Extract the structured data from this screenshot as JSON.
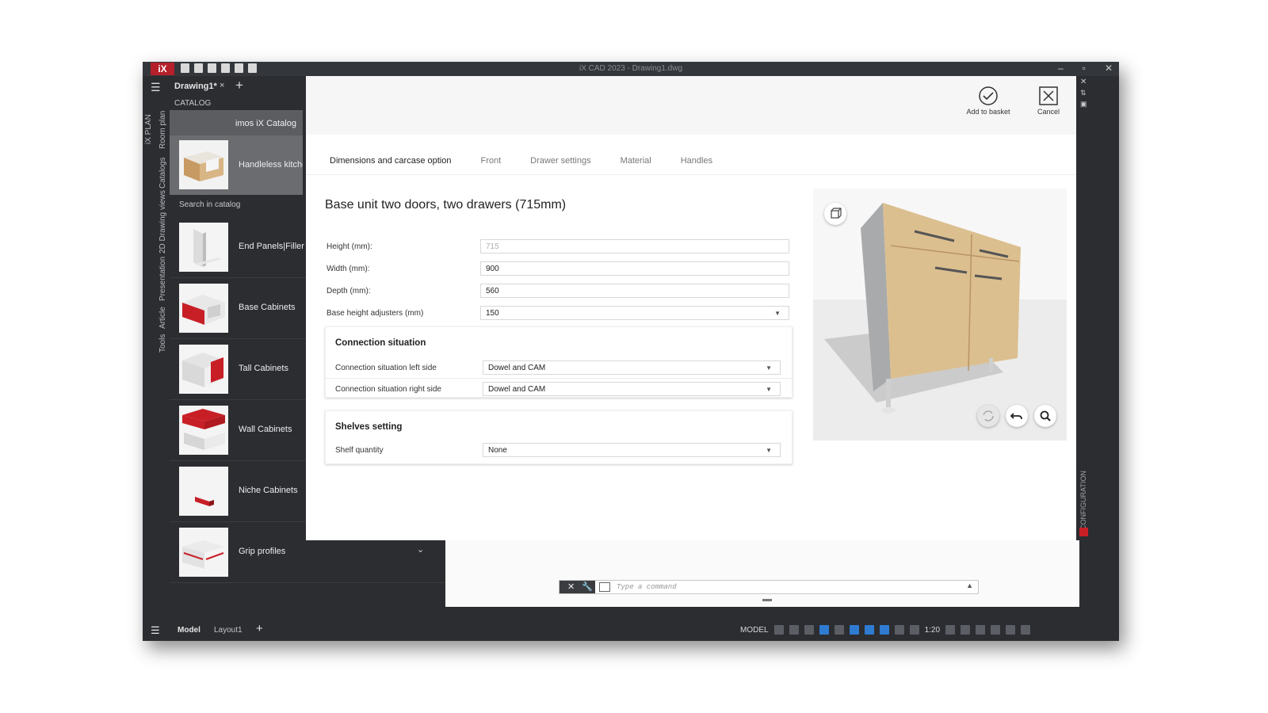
{
  "window": {
    "title": "iX CAD 2023 - Drawing1.dwg",
    "logo_text": "iX"
  },
  "tabs": {
    "document": "Drawing1*"
  },
  "vertical_tabs": [
    "iX PLAN",
    "Room plan",
    "Catalogs",
    "2D Drawing views",
    "Presentation",
    "Article",
    "Tools"
  ],
  "catalog": {
    "header": "CATALOG",
    "root": "imos iX Catalog",
    "selected": "Handleless kitche",
    "search_placeholder": "Search in catalog",
    "items": [
      {
        "label": "End Panels|Filler"
      },
      {
        "label": "Base Cabinets"
      },
      {
        "label": "Tall Cabinets"
      },
      {
        "label": "Wall Cabinets"
      },
      {
        "label": "Niche Cabinets"
      },
      {
        "label": "Grip profiles"
      }
    ]
  },
  "config": {
    "actions": {
      "add": "Add to basket",
      "cancel": "Cancel"
    },
    "tabs": [
      "Dimensions and carcase option",
      "Front",
      "Drawer settings",
      "Material",
      "Handles"
    ],
    "title": "Base unit two doors, two drawers (715mm)",
    "fields": {
      "height_label": "Height (mm):",
      "height_value": "715",
      "width_label": "Width (mm):",
      "width_value": "900",
      "depth_label": "Depth (mm):",
      "depth_value": "560",
      "adjusters_label": "Base height adjusters (mm)",
      "adjusters_value": "150"
    },
    "connection": {
      "title": "Connection situation",
      "left_label": "Connection situation left side",
      "left_value": "Dowel and CAM",
      "right_label": "Connection situation right side",
      "right_value": "Dowel and CAM"
    },
    "shelves": {
      "title": "Shelves setting",
      "qty_label": "Shelf quantity",
      "qty_value": "None"
    },
    "side_label": "CONFIGURATION"
  },
  "command": {
    "placeholder": "Type a command"
  },
  "status": {
    "model_tab": "Model",
    "layout_tab": "Layout1",
    "space": "MODEL",
    "scale": "1:20"
  },
  "colors": {
    "accent_red": "#b5202a",
    "panel_dark": "#2b2d31",
    "wood": "#dcbf8f"
  }
}
